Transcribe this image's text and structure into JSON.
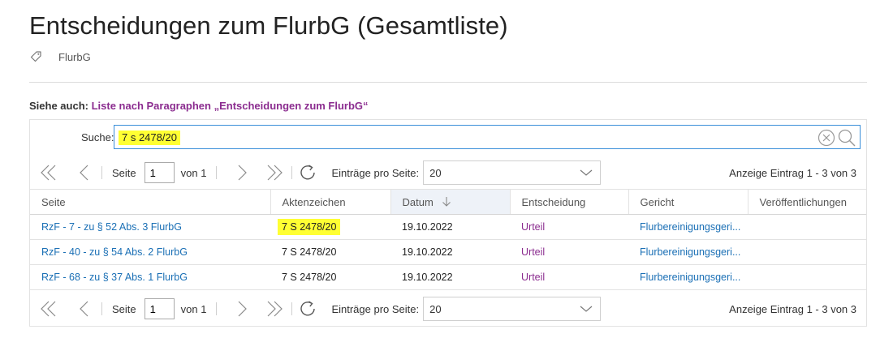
{
  "page": {
    "title": "Entscheidungen zum FlurbG (Gesamtliste)",
    "tag": "FlurbG"
  },
  "see_also": {
    "label": "Siehe auch:",
    "link": "Liste nach Paragraphen „Entscheidungen zum FlurbG“"
  },
  "search": {
    "label": "Suche:",
    "value": "7 s 2478/20"
  },
  "pager": {
    "page_label": "Seite",
    "page_value": "1",
    "of_label": "von 1",
    "per_page_label": "Einträge pro Seite:",
    "per_page_value": "20",
    "info": "Anzeige Eintrag 1 - 3 von 3"
  },
  "table": {
    "columns": [
      "Seite",
      "Aktenzeichen",
      "Datum",
      "Entscheidung",
      "Gericht",
      "Veröffentlichungen"
    ],
    "sorted_column": "Datum",
    "rows": [
      {
        "seite": "RzF - 7 - zu § 52 Abs. 3 FlurbG",
        "aktenzeichen": "7 S 2478/20",
        "datum": "19.10.2022",
        "entscheidung": "Urteil",
        "gericht": "Flurbereinigungsgeri...",
        "veroeffentlichungen": ""
      },
      {
        "seite": "RzF - 40 - zu § 54 Abs. 2 FlurbG",
        "aktenzeichen": "7 S 2478/20",
        "datum": "19.10.2022",
        "entscheidung": "Urteil",
        "gericht": "Flurbereinigungsgeri...",
        "veroeffentlichungen": ""
      },
      {
        "seite": "RzF - 68 - zu § 37 Abs. 1 FlurbG",
        "aktenzeichen": "7 S 2478/20",
        "datum": "19.10.2022",
        "entscheidung": "Urteil",
        "gericht": "Flurbereinigungsgeri...",
        "veroeffentlichungen": ""
      }
    ]
  },
  "icons": {
    "tag": "tag-icon",
    "clear": "clear-circle-x-icon",
    "search": "magnifier-icon",
    "first": "double-chevron-left-icon",
    "prev": "chevron-left-icon",
    "next": "chevron-right-icon",
    "last": "double-chevron-right-icon",
    "refresh": "refresh-icon",
    "dropdown": "chevron-down-icon",
    "sort": "arrow-down-icon"
  },
  "colors": {
    "link_blue": "#1a6fb5",
    "link_purple": "#8b2c8f",
    "highlight": "#ffff33",
    "focus_border": "#3b8fd9"
  }
}
